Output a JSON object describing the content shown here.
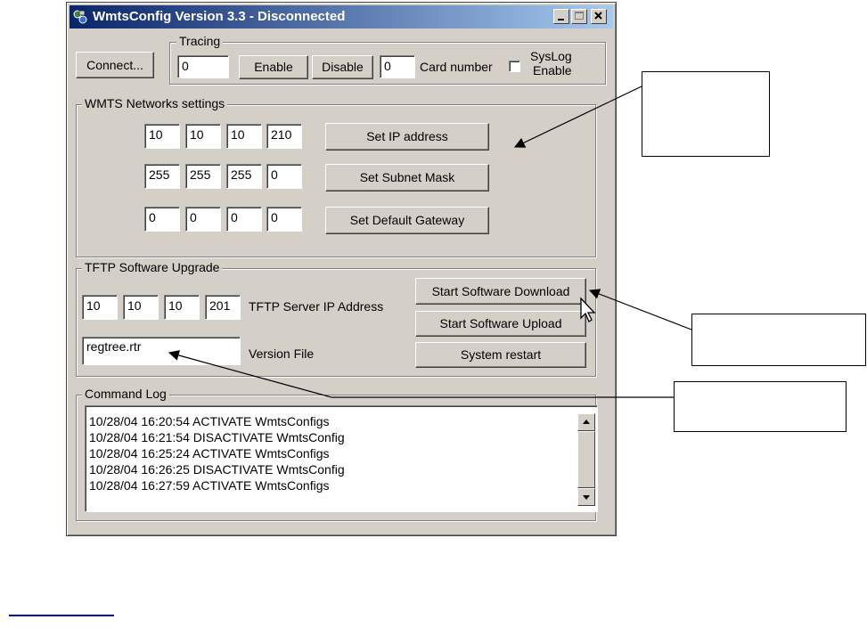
{
  "window": {
    "title": "WmtsConfig Version 3.3 - Disconnected"
  },
  "toolbar": {
    "connect_label": "Connect..."
  },
  "tracing": {
    "legend": "Tracing",
    "value": "0",
    "enable_label": "Enable",
    "disable_label": "Disable",
    "card_number_value": "0",
    "card_number_label": "Card number",
    "syslog_label_line1": "SysLog",
    "syslog_label_line2": "Enable",
    "syslog_checked": false
  },
  "network": {
    "legend": "WMTS Networks settings",
    "ip": [
      "10",
      "10",
      "10",
      "210"
    ],
    "subnet": [
      "255",
      "255",
      "255",
      "0"
    ],
    "gateway": [
      "0",
      "0",
      "0",
      "0"
    ],
    "set_ip_label": "Set IP address",
    "set_subnet_label": "Set Subnet Mask",
    "set_gateway_label": "Set Default Gateway"
  },
  "tftp": {
    "legend": "TFTP Software Upgrade",
    "server_ip": [
      "10",
      "10",
      "10",
      "201"
    ],
    "server_ip_label": "TFTP Server IP Address",
    "version_file_value": "regtree.rtr",
    "version_file_label": "Version File",
    "download_label": "Start Software Download",
    "upload_label": "Start Software Upload",
    "restart_label": "System restart"
  },
  "command_log": {
    "legend": "Command Log",
    "lines": [
      "10/28/04 16:20:54 ACTIVATE WmtsConfigs",
      "10/28/04 16:21:54 DISACTIVATE WmtsConfig",
      "10/28/04 16:25:24 ACTIVATE WmtsConfigs",
      "10/28/04 16:26:25 DISACTIVATE WmtsConfig",
      "10/28/04 16:27:59 ACTIVATE WmtsConfigs"
    ]
  },
  "colors": {
    "titlebar_start": "#0a246a",
    "titlebar_end": "#a6caf0",
    "face": "#d4d0c8"
  }
}
